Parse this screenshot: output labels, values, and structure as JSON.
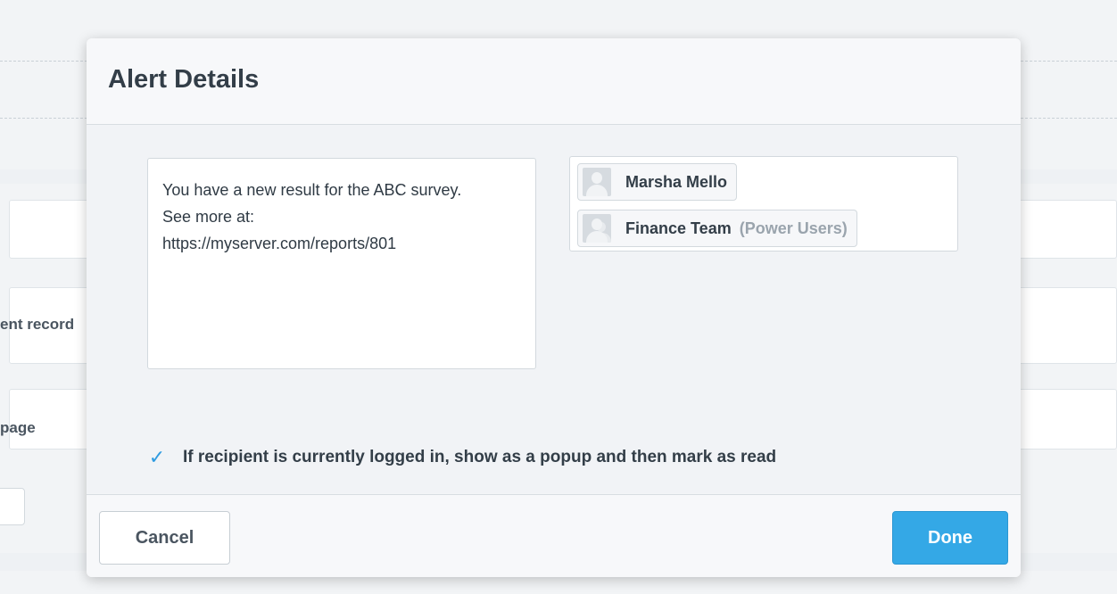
{
  "background": {
    "row_label_1": "ent record",
    "row_label_2": "page"
  },
  "dialog": {
    "title": "Alert Details",
    "message_lines": [
      "You have a new result for the ABC survey.",
      "See more at:",
      "https://myserver.com/reports/801"
    ],
    "recipients": [
      {
        "name": "Marsha Mello",
        "subtitle": "",
        "icon": "user-avatar-icon"
      },
      {
        "name": "Finance Team",
        "subtitle": "(Power Users)",
        "icon": "group-avatar-icon"
      }
    ],
    "popup_option": {
      "checked": true,
      "label": "If recipient is currently logged in, show as a popup and then mark as read"
    },
    "cancel_label": "Cancel",
    "done_label": "Done"
  },
  "colors": {
    "accent": "#34a8e6",
    "checkmark": "#2f9be0"
  }
}
